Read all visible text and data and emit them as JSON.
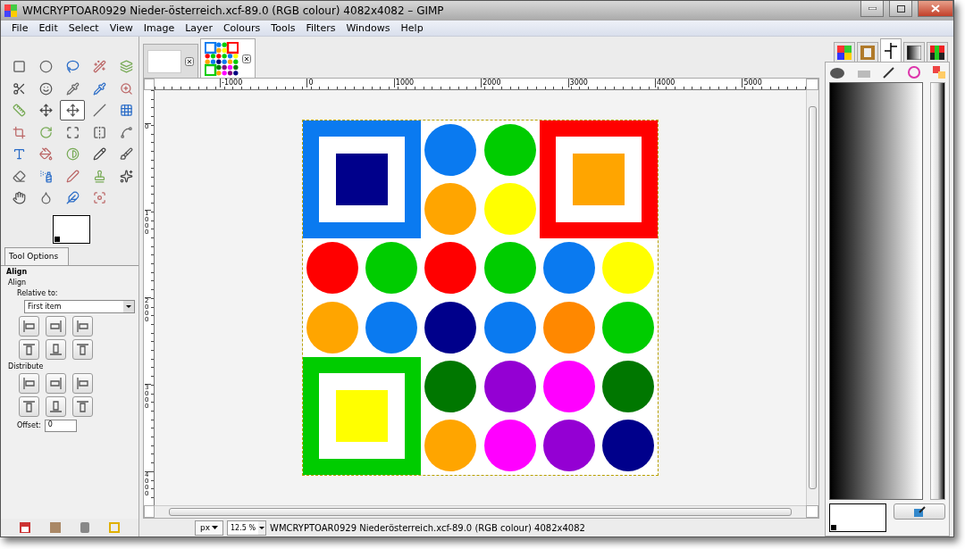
{
  "window": {
    "title": "WMCRYPTOAR0929 Nieder-österreich.xcf-89.0 (RGB colour) 4082x4082 – GIMP"
  },
  "menu": [
    "File",
    "Edit",
    "Select",
    "View",
    "Image",
    "Layer",
    "Colours",
    "Tools",
    "Filters",
    "Windows",
    "Help"
  ],
  "toolbox": {
    "tools": [
      {
        "selected": false
      },
      {
        "selected": false
      },
      {
        "selected": false
      },
      {
        "selected": false
      },
      {
        "selected": false
      },
      {
        "selected": false
      },
      {
        "selected": false
      },
      {
        "selected": false
      },
      {
        "selected": false
      },
      {
        "selected": false
      },
      {
        "selected": false
      },
      {
        "selected": false
      },
      {
        "selected": true
      },
      {
        "selected": false
      },
      {
        "selected": false
      },
      {
        "selected": false
      },
      {
        "selected": false
      },
      {
        "selected": false
      },
      {
        "selected": false
      },
      {
        "selected": false
      },
      {
        "selected": false
      },
      {
        "selected": false
      },
      {
        "selected": false
      },
      {
        "selected": false
      },
      {
        "selected": false
      },
      {
        "selected": false
      },
      {
        "selected": false
      },
      {
        "selected": false
      },
      {
        "selected": false
      },
      {
        "selected": false
      },
      {
        "selected": false
      },
      {
        "selected": false
      },
      {
        "selected": false
      },
      {
        "selected": false
      }
    ]
  },
  "tool_options": {
    "tab": "Tool Options",
    "heading": "Align",
    "subheading": "Align",
    "relative_label": "Relative to:",
    "relative_value": "First item",
    "distribute_label": "Distribute",
    "offset_label": "Offset:",
    "offset_value": "0"
  },
  "image_tabs": [
    {
      "kind": "blank",
      "selected": false
    },
    {
      "kind": "thumb",
      "selected": true
    }
  ],
  "rulers": {
    "horizontal": [
      "-1000",
      "0",
      "1000",
      "2000",
      "3000",
      "4000",
      "5000"
    ],
    "vertical": [
      "0",
      "1000",
      "2000",
      "3000",
      "4000"
    ]
  },
  "image": {
    "shapes": [
      {
        "kind": "frame",
        "color": "#0a7af0",
        "inner": {
          "color": "#00008b"
        }
      },
      {
        "kind": "circle",
        "color": "#0a7af0"
      },
      {
        "kind": "circle",
        "color": "#00cc00"
      },
      {
        "kind": "frame",
        "color": "#ff0000",
        "inner": {
          "color": "#ffa500"
        }
      },
      {
        "kind": "circle",
        "color": "#ffa500"
      },
      {
        "kind": "circle",
        "color": "#ffff00"
      },
      {
        "kind": "circle",
        "color": "#ff0000"
      },
      {
        "kind": "circle",
        "color": "#00cc00"
      },
      {
        "kind": "circle",
        "color": "#ff0000"
      },
      {
        "kind": "circle",
        "color": "#00cc00"
      },
      {
        "kind": "circle",
        "color": "#0a7af0"
      },
      {
        "kind": "circle",
        "color": "#ffff00"
      },
      {
        "kind": "circle",
        "color": "#ffa500"
      },
      {
        "kind": "circle",
        "color": "#0a7af0"
      },
      {
        "kind": "circle",
        "color": "#00008b"
      },
      {
        "kind": "circle",
        "color": "#0a7af0"
      },
      {
        "kind": "circle",
        "color": "#ff8800"
      },
      {
        "kind": "circle",
        "color": "#00cc00"
      },
      {
        "kind": "frame",
        "color": "#00cc00",
        "inner": {
          "color": "#ffff00"
        }
      },
      {
        "kind": "circle",
        "color": "#007700"
      },
      {
        "kind": "circle",
        "color": "#9400d3"
      },
      {
        "kind": "circle",
        "color": "#ff00ff"
      },
      {
        "kind": "circle",
        "color": "#007700"
      },
      {
        "kind": "circle",
        "color": "#ffa500"
      },
      {
        "kind": "circle",
        "color": "#ff00ff"
      },
      {
        "kind": "circle",
        "color": "#9400d3"
      },
      {
        "kind": "circle",
        "color": "#00008b"
      }
    ]
  },
  "status": {
    "unit": "px",
    "zoom": "12.5 %",
    "text": "WMCRYPTOAR0929 Niederösterreich.xcf-89.0 (RGB colour) 4082x4082"
  }
}
